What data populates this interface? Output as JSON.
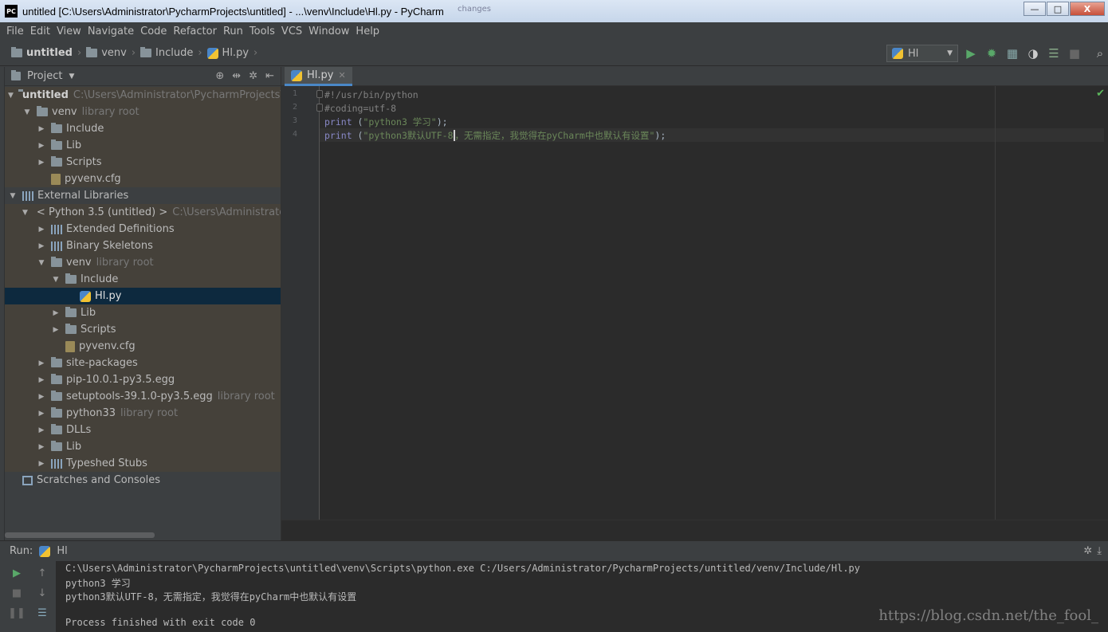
{
  "window": {
    "title": "untitled [C:\\Users\\Administrator\\PycharmProjects\\untitled] - ...\\venv\\Include\\Hl.py - PyCharm",
    "app_icon": "PC",
    "taskbar_hints": [
      "changes",
      "",
      "",
      "",
      ""
    ],
    "min": "—",
    "max": "□",
    "close": "X"
  },
  "menu": [
    "File",
    "Edit",
    "View",
    "Navigate",
    "Code",
    "Refactor",
    "Run",
    "Tools",
    "VCS",
    "Window",
    "Help"
  ],
  "breadcrumb": [
    "untitled",
    "venv",
    "Include",
    "Hl.py"
  ],
  "run_config": "Hl",
  "project_panel": {
    "title": "Project"
  },
  "tree": [
    {
      "label": "untitled",
      "hint": "C:\\Users\\Administrator\\PycharmProjects\\un",
      "indent": 0,
      "toggle": "open",
      "icon": "folder",
      "bold": true,
      "bg": "brown"
    },
    {
      "label": "venv",
      "hint": "library root",
      "indent": 1,
      "toggle": "open",
      "icon": "folder",
      "bg": "brown"
    },
    {
      "label": "Include",
      "hint": "",
      "indent": 2,
      "toggle": "closed",
      "icon": "folder",
      "bg": "brown"
    },
    {
      "label": "Lib",
      "hint": "",
      "indent": 2,
      "toggle": "closed",
      "icon": "folder",
      "bg": "brown"
    },
    {
      "label": "Scripts",
      "hint": "",
      "indent": 2,
      "toggle": "closed",
      "icon": "folder",
      "bg": "brown"
    },
    {
      "label": "pyvenv.cfg",
      "hint": "",
      "indent": 2,
      "toggle": "none",
      "icon": "cfg",
      "bg": "brown"
    },
    {
      "label": "External Libraries",
      "hint": "",
      "indent": 0,
      "toggle": "open",
      "icon": "bars",
      "bg": ""
    },
    {
      "label": "< Python 3.5 (untitled) >",
      "hint": "C:\\Users\\Administrator\\P",
      "indent": 1,
      "toggle": "open",
      "icon": "python",
      "bg": "brown"
    },
    {
      "label": "Extended Definitions",
      "hint": "",
      "indent": 2,
      "toggle": "closed",
      "icon": "bars",
      "bg": "brown"
    },
    {
      "label": "Binary Skeletons",
      "hint": "",
      "indent": 2,
      "toggle": "closed",
      "icon": "bars",
      "bg": "brown"
    },
    {
      "label": "venv",
      "hint": "library root",
      "indent": 2,
      "toggle": "open",
      "icon": "folder",
      "bg": "brown"
    },
    {
      "label": "Include",
      "hint": "",
      "indent": 3,
      "toggle": "open",
      "icon": "folder",
      "bg": "brown"
    },
    {
      "label": "Hl.py",
      "hint": "",
      "indent": 4,
      "toggle": "none",
      "icon": "python",
      "bg": "sel"
    },
    {
      "label": "Lib",
      "hint": "",
      "indent": 3,
      "toggle": "closed",
      "icon": "folder",
      "bg": "brown"
    },
    {
      "label": "Scripts",
      "hint": "",
      "indent": 3,
      "toggle": "closed",
      "icon": "folder",
      "bg": "brown"
    },
    {
      "label": "pyvenv.cfg",
      "hint": "",
      "indent": 3,
      "toggle": "none",
      "icon": "cfg",
      "bg": "brown"
    },
    {
      "label": "site-packages",
      "hint": "",
      "indent": 2,
      "toggle": "closed",
      "icon": "folder",
      "bg": "brown"
    },
    {
      "label": "pip-10.0.1-py3.5.egg",
      "hint": "",
      "indent": 2,
      "toggle": "closed",
      "icon": "folder",
      "bg": "brown"
    },
    {
      "label": "setuptools-39.1.0-py3.5.egg",
      "hint": "library root",
      "indent": 2,
      "toggle": "closed",
      "icon": "folder",
      "bg": "brown"
    },
    {
      "label": "python33",
      "hint": "library root",
      "indent": 2,
      "toggle": "closed",
      "icon": "folder",
      "bg": "brown"
    },
    {
      "label": "DLLs",
      "hint": "",
      "indent": 2,
      "toggle": "closed",
      "icon": "folder",
      "bg": "brown"
    },
    {
      "label": "Lib",
      "hint": "",
      "indent": 2,
      "toggle": "closed",
      "icon": "folder",
      "bg": "brown"
    },
    {
      "label": "Typeshed Stubs",
      "hint": "",
      "indent": 2,
      "toggle": "closed",
      "icon": "bars",
      "bg": "brown"
    },
    {
      "label": "Scratches and Consoles",
      "hint": "",
      "indent": 0,
      "toggle": "none",
      "icon": "scratch",
      "bg": ""
    }
  ],
  "editor": {
    "tab": "Hl.py",
    "lines": [
      {
        "n": "1",
        "parts": [
          {
            "c": "cm",
            "t": "#!/usr/bin/python"
          }
        ]
      },
      {
        "n": "2",
        "parts": [
          {
            "c": "cm",
            "t": "#coding=utf-8"
          }
        ]
      },
      {
        "n": "3",
        "parts": [
          {
            "c": "kw",
            "t": "print"
          },
          {
            "c": "pl",
            "t": " ("
          },
          {
            "c": "st",
            "t": "\"python3 学习\""
          },
          {
            "c": "pl",
            "t": ");"
          }
        ]
      },
      {
        "n": "4",
        "parts": [
          {
            "c": "kw",
            "t": "print"
          },
          {
            "c": "pl",
            "t": " ("
          },
          {
            "c": "st",
            "t": "\"python3默认UTF-8"
          },
          {
            "c": "caret",
            "t": ""
          },
          {
            "c": "st",
            "t": "，无需指定，我觉得在pyCharm中也默认有设置\""
          },
          {
            "c": "pl",
            "t": ");"
          }
        ]
      }
    ],
    "check": "✔"
  },
  "run": {
    "label": "Run:",
    "tab": "Hl",
    "output": [
      "C:\\Users\\Administrator\\PycharmProjects\\untitled\\venv\\Scripts\\python.exe C:/Users/Administrator/PycharmProjects/untitled/venv/Include/Hl.py",
      "python3 学习",
      "python3默认UTF-8，无需指定，我觉得在pyCharm中也默认有设置",
      "",
      "Process finished with exit code 0"
    ]
  },
  "watermark": "https://blog.csdn.net/the_fool_",
  "colors": {
    "accent": "#4a88c7",
    "run_green": "#59a869",
    "selection": "#0d293e"
  }
}
